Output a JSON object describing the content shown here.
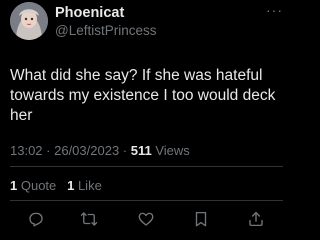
{
  "author": {
    "display_name": "Phoenicat",
    "handle": "@LeftistPrincess"
  },
  "more_icon": "···",
  "tweet": {
    "text": "What did she say? If she was hateful towards my existence I too would deck her"
  },
  "meta": {
    "time": "13:02",
    "date": "26/03/2023",
    "separator": " · ",
    "views_count": "511",
    "views_label": " Views"
  },
  "stats": {
    "quotes_count": "1",
    "quotes_label": " Quote",
    "likes_count": "1",
    "likes_label": " Like"
  },
  "actions": [
    "reply-icon",
    "retweet-icon",
    "like-icon",
    "bookmark-icon",
    "share-icon"
  ],
  "colors": {
    "background": "#000000",
    "primary_text": "#e7e9ea",
    "secondary_text": "#71767b",
    "divider": "#2f3336"
  }
}
